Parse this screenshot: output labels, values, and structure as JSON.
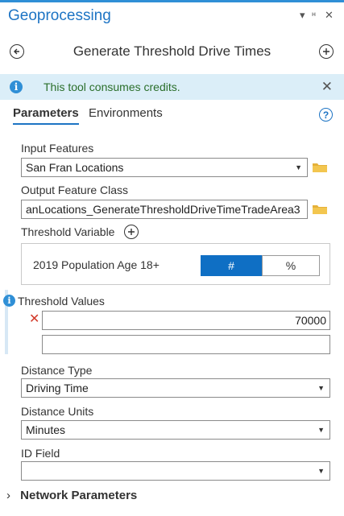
{
  "window": {
    "title": "Geoprocessing",
    "accent": "#1d74c4"
  },
  "tool": {
    "name": "Generate Threshold Drive Times"
  },
  "banner": {
    "message": "This tool consumes credits."
  },
  "tabs": [
    {
      "label": "Parameters",
      "active": true
    },
    {
      "label": "Environments",
      "active": false
    }
  ],
  "params": {
    "input_features": {
      "label": "Input Features",
      "value": "San Fran Locations"
    },
    "output_feature_class": {
      "label": "Output Feature Class",
      "value": "anLocations_GenerateThresholdDriveTimeTradeArea3"
    },
    "threshold_variable": {
      "label": "Threshold Variable",
      "variable_name": "2019 Population Age 18+",
      "toggle_options": [
        "#",
        "%"
      ],
      "selected": "#"
    },
    "threshold_values": {
      "label": "Threshold Values",
      "values": [
        "70000",
        ""
      ]
    },
    "distance_type": {
      "label": "Distance Type",
      "value": "Driving Time"
    },
    "distance_units": {
      "label": "Distance Units",
      "value": "Minutes"
    },
    "id_field": {
      "label": "ID Field",
      "value": ""
    },
    "network_parameters": {
      "label": "Network Parameters"
    }
  },
  "icons": {
    "back": "back-arrow-icon",
    "add": "add-icon",
    "info": "info-icon",
    "help": "help-icon",
    "folder": "folder-icon",
    "delete": "delete-icon"
  }
}
